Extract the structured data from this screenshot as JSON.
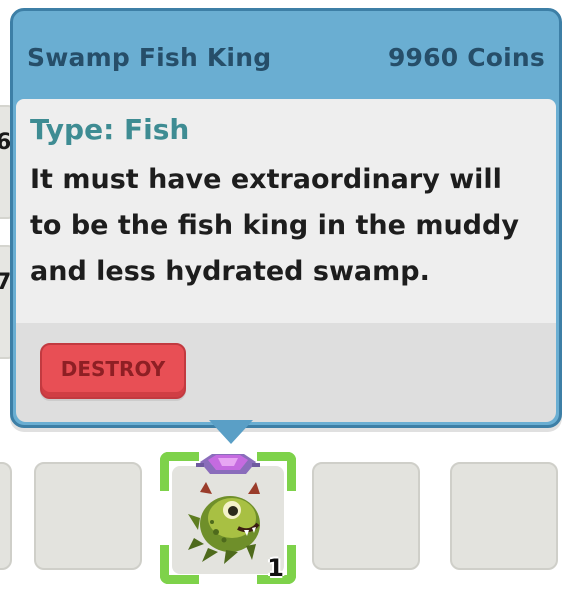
{
  "tooltip": {
    "item_name": "Swamp Fish King",
    "price": "9960 Coins",
    "type_label": "Type: Fish",
    "description": "It must have extraordinary will to be the fish king in the muddy and less hydrated swamp.",
    "destroy_label": "DESTROY"
  },
  "inventory": {
    "selected_slot": {
      "item_icon": "swamp-fish-king-sprite",
      "count": "1"
    },
    "edge_digits": [
      "6",
      "7"
    ]
  },
  "colors": {
    "tooltip_bg": "#6aaed2",
    "tooltip_border": "#3d7fa6",
    "header_text": "#264e69",
    "type_text": "#3e8c93",
    "destroy_button": "#e84f55",
    "selected_slot_frame": "#7ed24a",
    "rarity_gem": "#c56be0"
  }
}
